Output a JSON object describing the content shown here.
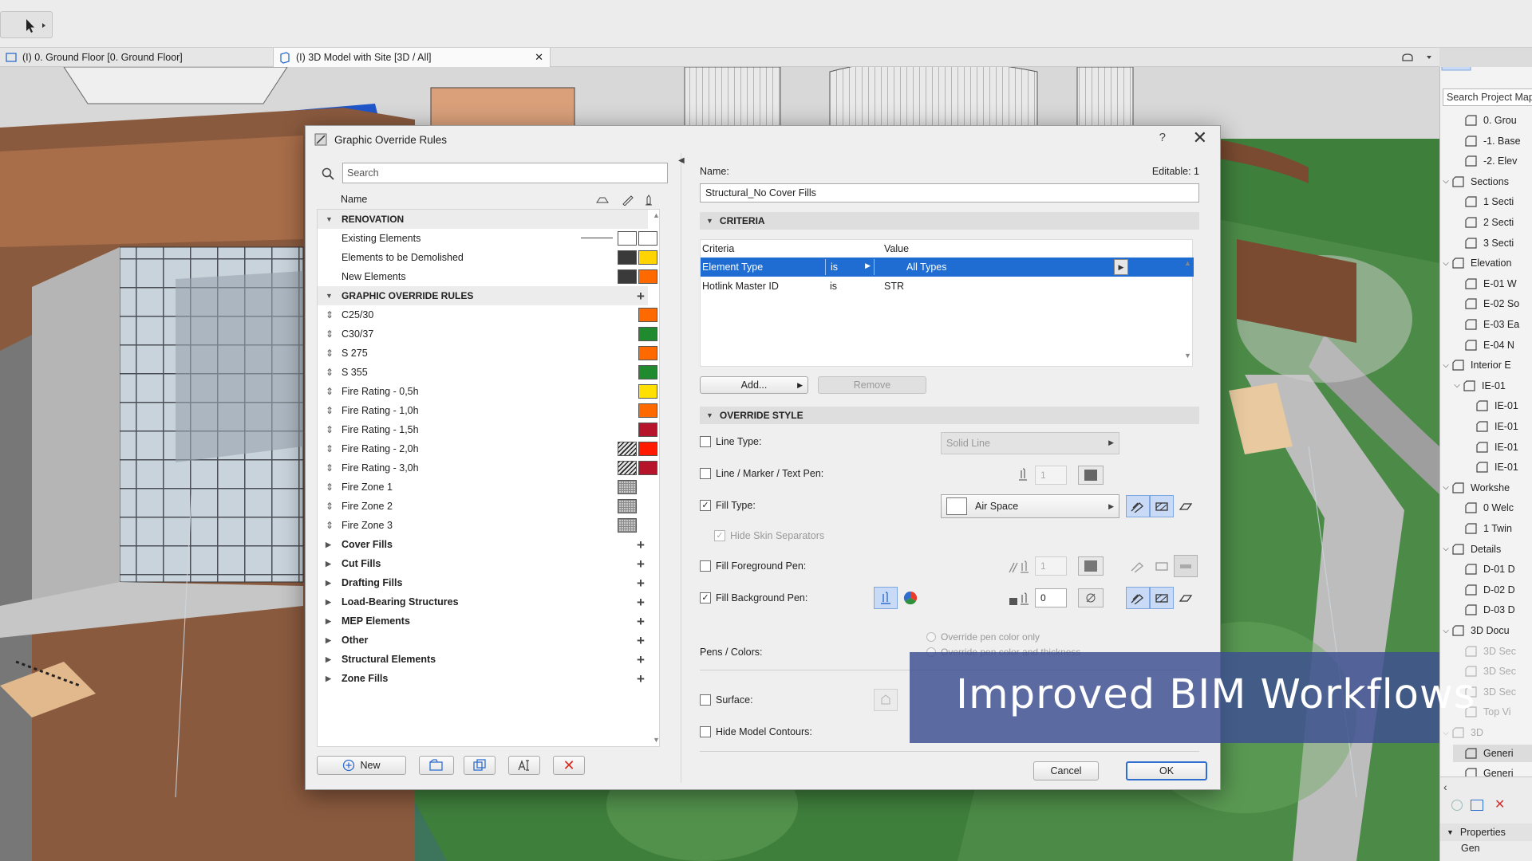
{
  "app": {
    "view_tabs": [
      {
        "label": "(I) 0. Ground Floor [0. Ground Floor]"
      },
      {
        "label": "(I) 3D Model with Site [3D / All]"
      }
    ]
  },
  "navigator": {
    "search_placeholder": "Search Project Map",
    "items": [
      {
        "label": "0. Grou"
      },
      {
        "label": "-1. Base"
      },
      {
        "label": "-2. Elev"
      },
      {
        "label": "Sections"
      },
      {
        "label": "1 Secti"
      },
      {
        "label": "2 Secti"
      },
      {
        "label": "3 Secti"
      },
      {
        "label": "Elevation"
      },
      {
        "label": "E-01 W"
      },
      {
        "label": "E-02 So"
      },
      {
        "label": "E-03 Ea"
      },
      {
        "label": "E-04 N"
      },
      {
        "label": "Interior E"
      },
      {
        "label": "IE-01"
      },
      {
        "label": "IE-01"
      },
      {
        "label": "IE-01"
      },
      {
        "label": "IE-01"
      },
      {
        "label": "IE-01"
      },
      {
        "label": "Workshe"
      },
      {
        "label": "0 Welc"
      },
      {
        "label": "1 Twin"
      },
      {
        "label": "Details"
      },
      {
        "label": "D-01 D"
      },
      {
        "label": "D-02 D"
      },
      {
        "label": "D-03 D"
      },
      {
        "label": "3D Docu"
      },
      {
        "label": "3D Sec"
      },
      {
        "label": "3D Sec"
      },
      {
        "label": "3D Sec"
      },
      {
        "label": "Top Vi"
      },
      {
        "label": "3D"
      },
      {
        "label": "Generi"
      },
      {
        "label": "Generi"
      }
    ],
    "properties_label": "Properties",
    "bottom_item": "Gen"
  },
  "dialog": {
    "title": "Graphic Override Rules",
    "help": "?",
    "close": "✕",
    "search_placeholder": "Search",
    "list_header": {
      "name": "Name"
    },
    "groups": {
      "renovation": "RENOVATION",
      "rules": "GRAPHIC OVERRIDE RULES"
    },
    "renovation_items": [
      {
        "label": "Existing Elements",
        "left": "#ffffff",
        "right": "#ffffff",
        "line": true
      },
      {
        "label": "Elements to be Demolished",
        "left": "#3a3a3a",
        "right": "#ffd400"
      },
      {
        "label": "New Elements",
        "left": "#3a3a3a",
        "right": "#ff6a00"
      }
    ],
    "rules": [
      {
        "label": "C25/30",
        "color": "#ff6a00",
        "pattern": "solid"
      },
      {
        "label": "C30/37",
        "color": "#1f8a2e",
        "pattern": "solid"
      },
      {
        "label": "S 275",
        "color": "#ff6a00",
        "pattern": "solid"
      },
      {
        "label": "S 355",
        "color": "#1f8a2e",
        "pattern": "solid"
      },
      {
        "label": "Fire Rating - 0,5h",
        "color": "#ffe000",
        "pattern": "solid"
      },
      {
        "label": "Fire Rating - 1,0h",
        "color": "#ff6a00",
        "pattern": "solid"
      },
      {
        "label": "Fire Rating - 1,5h",
        "color": "#b5142a",
        "pattern": "solid"
      },
      {
        "label": "Fire Rating - 2,0h",
        "color": "#ff1a00",
        "pattern": "hatch"
      },
      {
        "label": "Fire Rating - 3,0h",
        "color": "#b5142a",
        "pattern": "hatch"
      },
      {
        "label": "Fire Zone 1",
        "color": "#cccccc",
        "pattern": "grid"
      },
      {
        "label": "Fire Zone 2",
        "color": "#cccccc",
        "pattern": "grid"
      },
      {
        "label": "Fire Zone 3",
        "color": "#cccccc",
        "pattern": "grid"
      }
    ],
    "categories": [
      {
        "label": "Cover Fills"
      },
      {
        "label": "Cut Fills"
      },
      {
        "label": "Drafting Fills"
      },
      {
        "label": "Load-Bearing Structures"
      },
      {
        "label": "MEP Elements"
      },
      {
        "label": "Other"
      },
      {
        "label": "Structural Elements"
      },
      {
        "label": "Zone Fills"
      }
    ],
    "new_button": "New",
    "name_label": "Name:",
    "editable_label": "Editable: 1",
    "name_value": "Structural_No Cover Fills",
    "criteria_section": "CRITERIA",
    "criteria_head": {
      "criteria": "Criteria",
      "value": "Value"
    },
    "criteria_rows": [
      {
        "criteria": "Element Type",
        "op": "is",
        "value": "All Types"
      },
      {
        "criteria": "Hotlink Master ID",
        "op": "is",
        "value": "STR"
      }
    ],
    "add_button": "Add...",
    "remove_button": "Remove",
    "override_section": "OVERRIDE STYLE",
    "line_type": {
      "label": "Line Type:",
      "value": "Solid Line",
      "checked": false
    },
    "line_marker_pen": {
      "label": "Line / Marker / Text Pen:",
      "pen": "1",
      "checked": false
    },
    "fill_type": {
      "label": "Fill Type:",
      "value": "Air Space",
      "checked": true
    },
    "hide_skin": {
      "label": "Hide Skin Separators",
      "checked": true
    },
    "fill_fg_pen": {
      "label": "Fill Foreground Pen:",
      "pen": "1",
      "checked": false
    },
    "fill_bg_pen": {
      "label": "Fill Background Pen:",
      "pen": "0",
      "checked": true
    },
    "pens_colors_label": "Pens / Colors:",
    "radio_1": "Override pen color only",
    "radio_2": "Override pen color and thickness",
    "surface": {
      "label": "Surface:",
      "checked": false
    },
    "hide_contours": {
      "label": "Hide Model Contours:",
      "checked": false
    },
    "cancel": "Cancel",
    "ok": "OK"
  },
  "banner": {
    "text": "Improved BIM Workflows"
  },
  "colors": {
    "accent": "#1f6dd2",
    "banner_bg": "#3e5091"
  }
}
